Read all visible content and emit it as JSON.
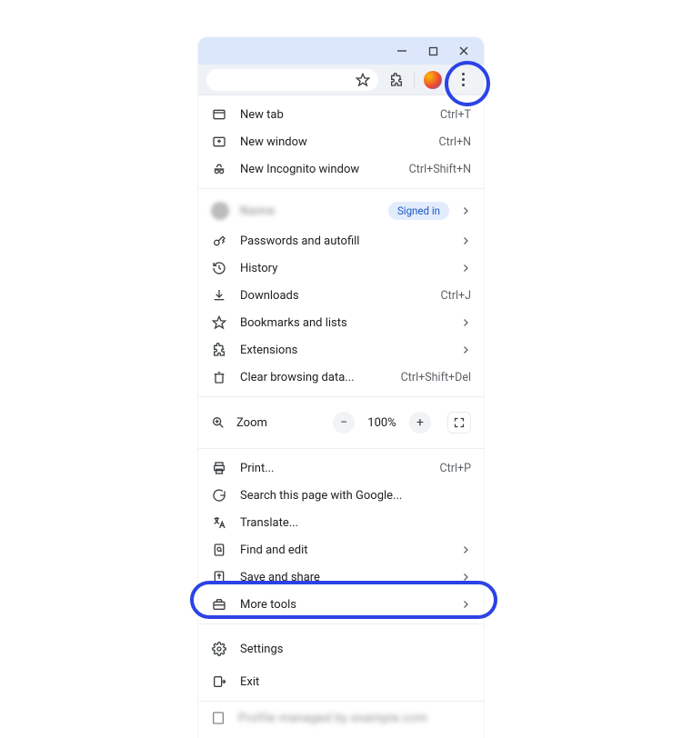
{
  "titlebar": {
    "minimize_tip": "Minimize",
    "maximize_tip": "Maximize",
    "close_tip": "Close"
  },
  "toolbar": {
    "star_tip": "Bookmark this tab",
    "ext_tip": "Extensions",
    "profile_tip": "Profile",
    "kebab_tip": "Customize and control Google Chrome"
  },
  "account": {
    "name_placeholder": "Name",
    "signed_in_label": "Signed in"
  },
  "menu": {
    "section1": [
      {
        "icon": "new-tab-icon",
        "label": "New tab",
        "shortcut": "Ctrl+T"
      },
      {
        "icon": "new-window-icon",
        "label": "New window",
        "shortcut": "Ctrl+N"
      },
      {
        "icon": "incognito-icon",
        "label": "New Incognito window",
        "shortcut": "Ctrl+Shift+N"
      }
    ],
    "section2": [
      {
        "icon": "key-icon",
        "label": "Passwords and autofill",
        "chevron": true
      },
      {
        "icon": "history-icon",
        "label": "History",
        "chevron": true
      },
      {
        "icon": "download-icon",
        "label": "Downloads",
        "shortcut": "Ctrl+J"
      },
      {
        "icon": "star-icon",
        "label": "Bookmarks and lists",
        "chevron": true
      },
      {
        "icon": "puzzle-icon",
        "label": "Extensions",
        "chevron": true
      },
      {
        "icon": "trash-icon",
        "label": "Clear browsing data...",
        "shortcut": "Ctrl+Shift+Del"
      }
    ],
    "zoom": {
      "icon": "zoom-icon",
      "label": "Zoom",
      "minus": "−",
      "value": "100%",
      "plus": "+",
      "fullscreen_tip": "Full screen"
    },
    "section3": [
      {
        "icon": "print-icon",
        "label": "Print...",
        "shortcut": "Ctrl+P"
      },
      {
        "icon": "google-g-icon",
        "label": "Search this page with Google..."
      },
      {
        "icon": "translate-icon",
        "label": "Translate..."
      },
      {
        "icon": "find-icon",
        "label": "Find and edit",
        "chevron": true
      },
      {
        "icon": "share-icon",
        "label": "Save and share",
        "chevron": true
      },
      {
        "icon": "toolbox-icon",
        "label": "More tools",
        "chevron": true
      }
    ],
    "section4": [
      {
        "icon": "gear-icon",
        "label": "Settings"
      },
      {
        "icon": "exit-icon",
        "label": "Exit"
      }
    ],
    "footer": {
      "icon": "org-icon",
      "placeholder": "Profile managed by example.com"
    }
  },
  "highlights": {
    "kebab": true,
    "settings": true
  }
}
